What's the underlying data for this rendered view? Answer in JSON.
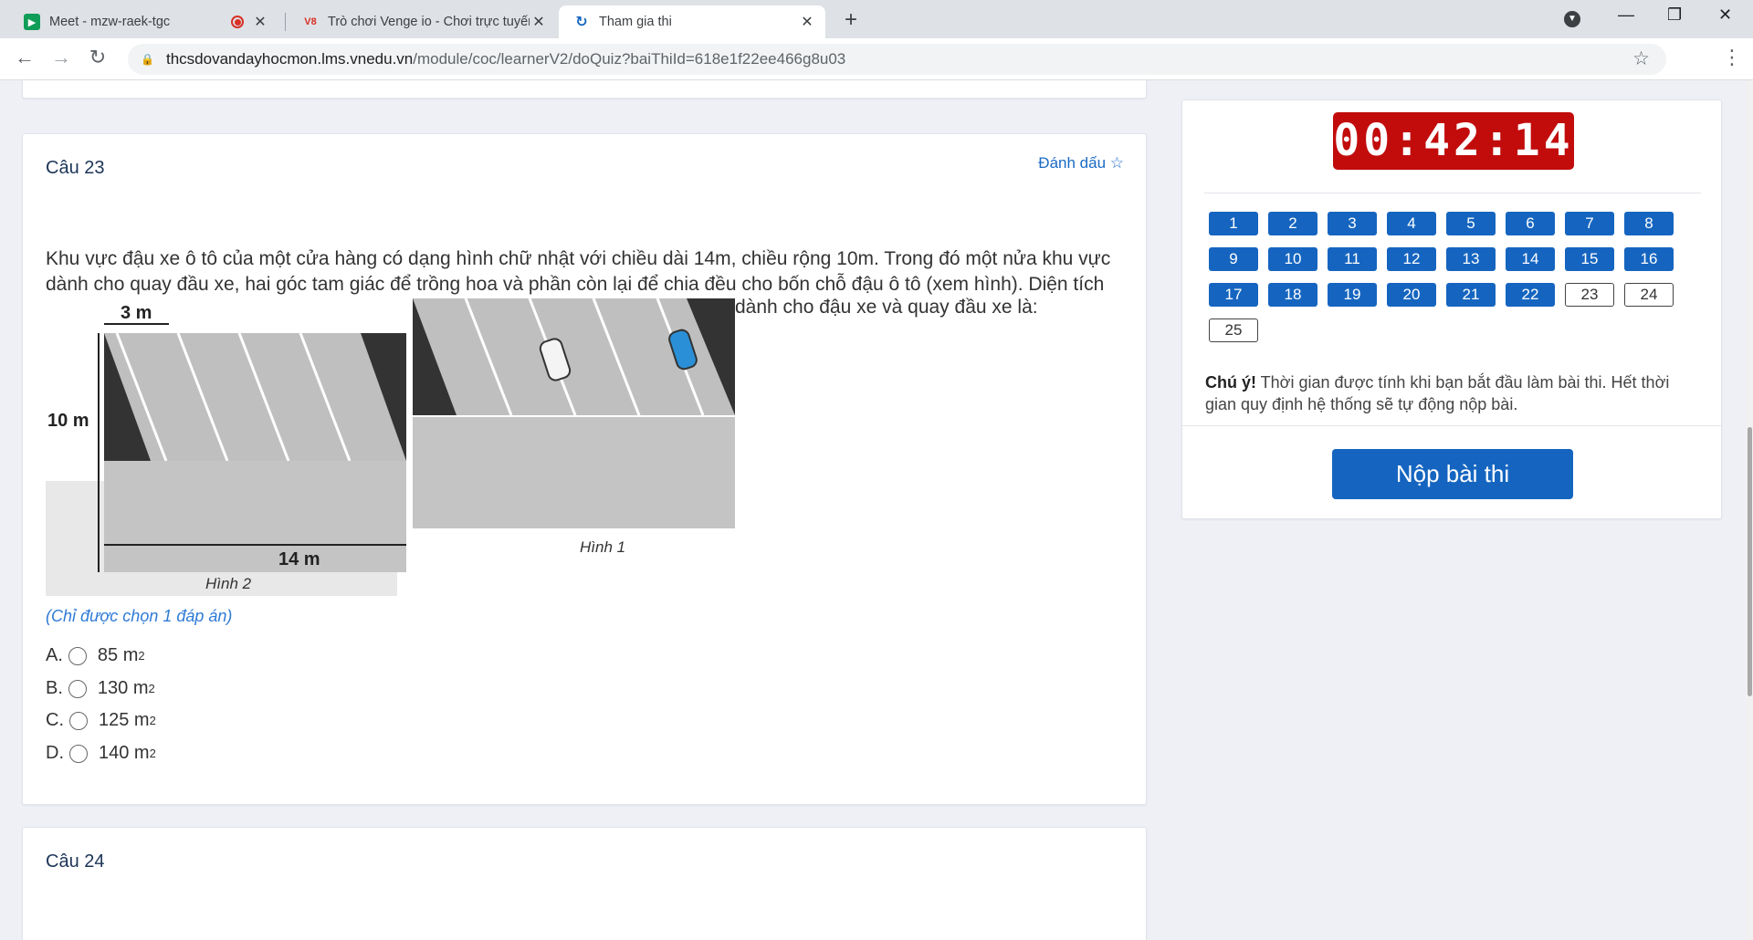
{
  "browser": {
    "tabs": [
      {
        "title": "Meet - mzw-raek-tgc"
      },
      {
        "title": "Trò chơi Venge io - Chơi trực tuyến"
      },
      {
        "title": "Tham gia thi"
      }
    ],
    "url_host": "thcsdovandayhocmon.lms.vnedu.vn",
    "url_path": "/module/coc/learnerV2/doQuiz?baiThiId=618e1f22ee466g8u03"
  },
  "question23": {
    "title": "Câu 23",
    "mark_label": "Đánh dấu ☆",
    "text_1": "Khu vực đậu xe ô tô của một cửa hàng có dạng hình chữ nhật với chiều dài 14m, chiều rộng 10m. Trong đó một nửa khu vực dành cho quay đầu xe, hai góc tam giác để trồng hoa và phần còn lại để chia đều cho bốn chỗ đậu ô tô (xem hình). Diện tích",
    "text_2": "dành cho đậu xe và quay đầu xe là:",
    "figure": {
      "label_width": "3 m",
      "label_height": "10 m",
      "label_length": "14 m",
      "caption_2": "Hình 2",
      "caption_1": "Hình 1"
    },
    "hint": "(Chỉ được chọn 1 đáp án)",
    "options": [
      {
        "letter": "A.",
        "value": "85 m",
        "exp": "2"
      },
      {
        "letter": "B.",
        "value": "130 m",
        "exp": "2"
      },
      {
        "letter": "C.",
        "value": "125 m",
        "exp": "2"
      },
      {
        "letter": "D.",
        "value": "140 m",
        "exp": "2"
      }
    ]
  },
  "question24": {
    "title": "Câu 24"
  },
  "sidebar": {
    "timer": "00:42:14",
    "questions": [
      {
        "n": "1",
        "done": true
      },
      {
        "n": "2",
        "done": true
      },
      {
        "n": "3",
        "done": true
      },
      {
        "n": "4",
        "done": true
      },
      {
        "n": "5",
        "done": true
      },
      {
        "n": "6",
        "done": true
      },
      {
        "n": "7",
        "done": true
      },
      {
        "n": "8",
        "done": true
      },
      {
        "n": "9",
        "done": true
      },
      {
        "n": "10",
        "done": true
      },
      {
        "n": "11",
        "done": true
      },
      {
        "n": "12",
        "done": true
      },
      {
        "n": "13",
        "done": true
      },
      {
        "n": "14",
        "done": true
      },
      {
        "n": "15",
        "done": true
      },
      {
        "n": "16",
        "done": true
      },
      {
        "n": "17",
        "done": true
      },
      {
        "n": "18",
        "done": true
      },
      {
        "n": "19",
        "done": true
      },
      {
        "n": "20",
        "done": true
      },
      {
        "n": "21",
        "done": true
      },
      {
        "n": "22",
        "done": true
      },
      {
        "n": "23",
        "done": false
      },
      {
        "n": "24",
        "done": false
      },
      {
        "n": "25",
        "done": false
      }
    ],
    "note_bold": "Chú ý!",
    "note_text": " Thời gian được tính khi bạn bắt đầu làm bài thi. Hết thời gian quy định hệ thống sẽ tự động nộp bài.",
    "submit_label": "Nộp bài thi"
  },
  "colors": {
    "primary": "#1565c0",
    "timer_bg": "#c20c0c"
  }
}
